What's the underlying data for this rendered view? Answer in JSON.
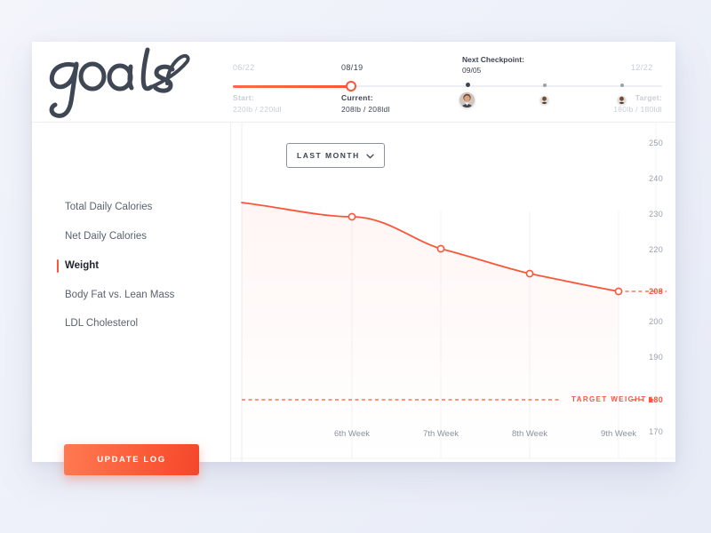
{
  "app": {
    "brand": "goals",
    "accent": "#f9563a",
    "card_bg": "#ffffff",
    "page_bg": "#eef1f9"
  },
  "timeline": {
    "start": {
      "date": "06/22",
      "label": "Start:",
      "value": "220lb / 220ldl"
    },
    "current": {
      "date": "08/19",
      "label": "Current:",
      "value": "208lb / 208ldl"
    },
    "checkpoint": {
      "label": "Next Checkpoint:",
      "date": "09/05"
    },
    "target": {
      "date": "12/22",
      "label": "Target:",
      "value": "180lb / 180ldl"
    },
    "markers": [
      {
        "name": "next-checkpoint-avatar",
        "x": 268,
        "size": 17
      },
      {
        "name": "checkpoint-2-avatar",
        "x": 355,
        "size": 9
      },
      {
        "name": "checkpoint-3-avatar",
        "x": 442,
        "size": 9
      }
    ]
  },
  "sidebar": {
    "items": [
      {
        "label": "Total Daily Calories",
        "active": false
      },
      {
        "label": "Net Daily Calories",
        "active": false
      },
      {
        "label": "Weight",
        "active": true
      },
      {
        "label": "Body Fat vs. Lean Mass",
        "active": false
      },
      {
        "label": "LDL Cholesterol",
        "active": false
      }
    ],
    "update_button": "UPDATE LOG"
  },
  "controls": {
    "range_label": "LAST MONTH",
    "chevron": "chevron-down-icon"
  },
  "chart_data": {
    "type": "line",
    "title": "Weight",
    "xlabel": "",
    "ylabel": "",
    "categories": [
      "6th Week",
      "7th Week",
      "8th Week",
      "9th Week"
    ],
    "series": [
      {
        "name": "Weight",
        "values": [
          228,
          221,
          214.5,
          208
        ],
        "color": "#f9563a"
      }
    ],
    "x": [
      360,
      460,
      560,
      660
    ],
    "start_value": 234,
    "yticks": [
      {
        "value": 250,
        "label": "250",
        "highlight": false
      },
      {
        "value": 240,
        "label": "240",
        "highlight": false
      },
      {
        "value": 230,
        "label": "230",
        "highlight": false
      },
      {
        "value": 220,
        "label": "220",
        "highlight": false
      },
      {
        "value": 208,
        "label": "208",
        "highlight": true
      },
      {
        "value": 200,
        "label": "200",
        "highlight": false
      },
      {
        "value": 190,
        "label": "190",
        "highlight": false
      },
      {
        "value": 180,
        "label": "180",
        "highlight": true
      },
      {
        "value": 170,
        "label": "170",
        "highlight": false
      }
    ],
    "ylim": [
      170,
      250
    ],
    "reference_lines": [
      {
        "name": "current-weight-line",
        "value": 208,
        "label": "208",
        "style": "dashed"
      },
      {
        "name": "target-weight-line",
        "value": 180,
        "label": "TARGET WEIGHT",
        "style": "dashed"
      }
    ],
    "target_weight_label": "TARGET WEIGHT",
    "grid": "vertical",
    "legend": "none"
  }
}
